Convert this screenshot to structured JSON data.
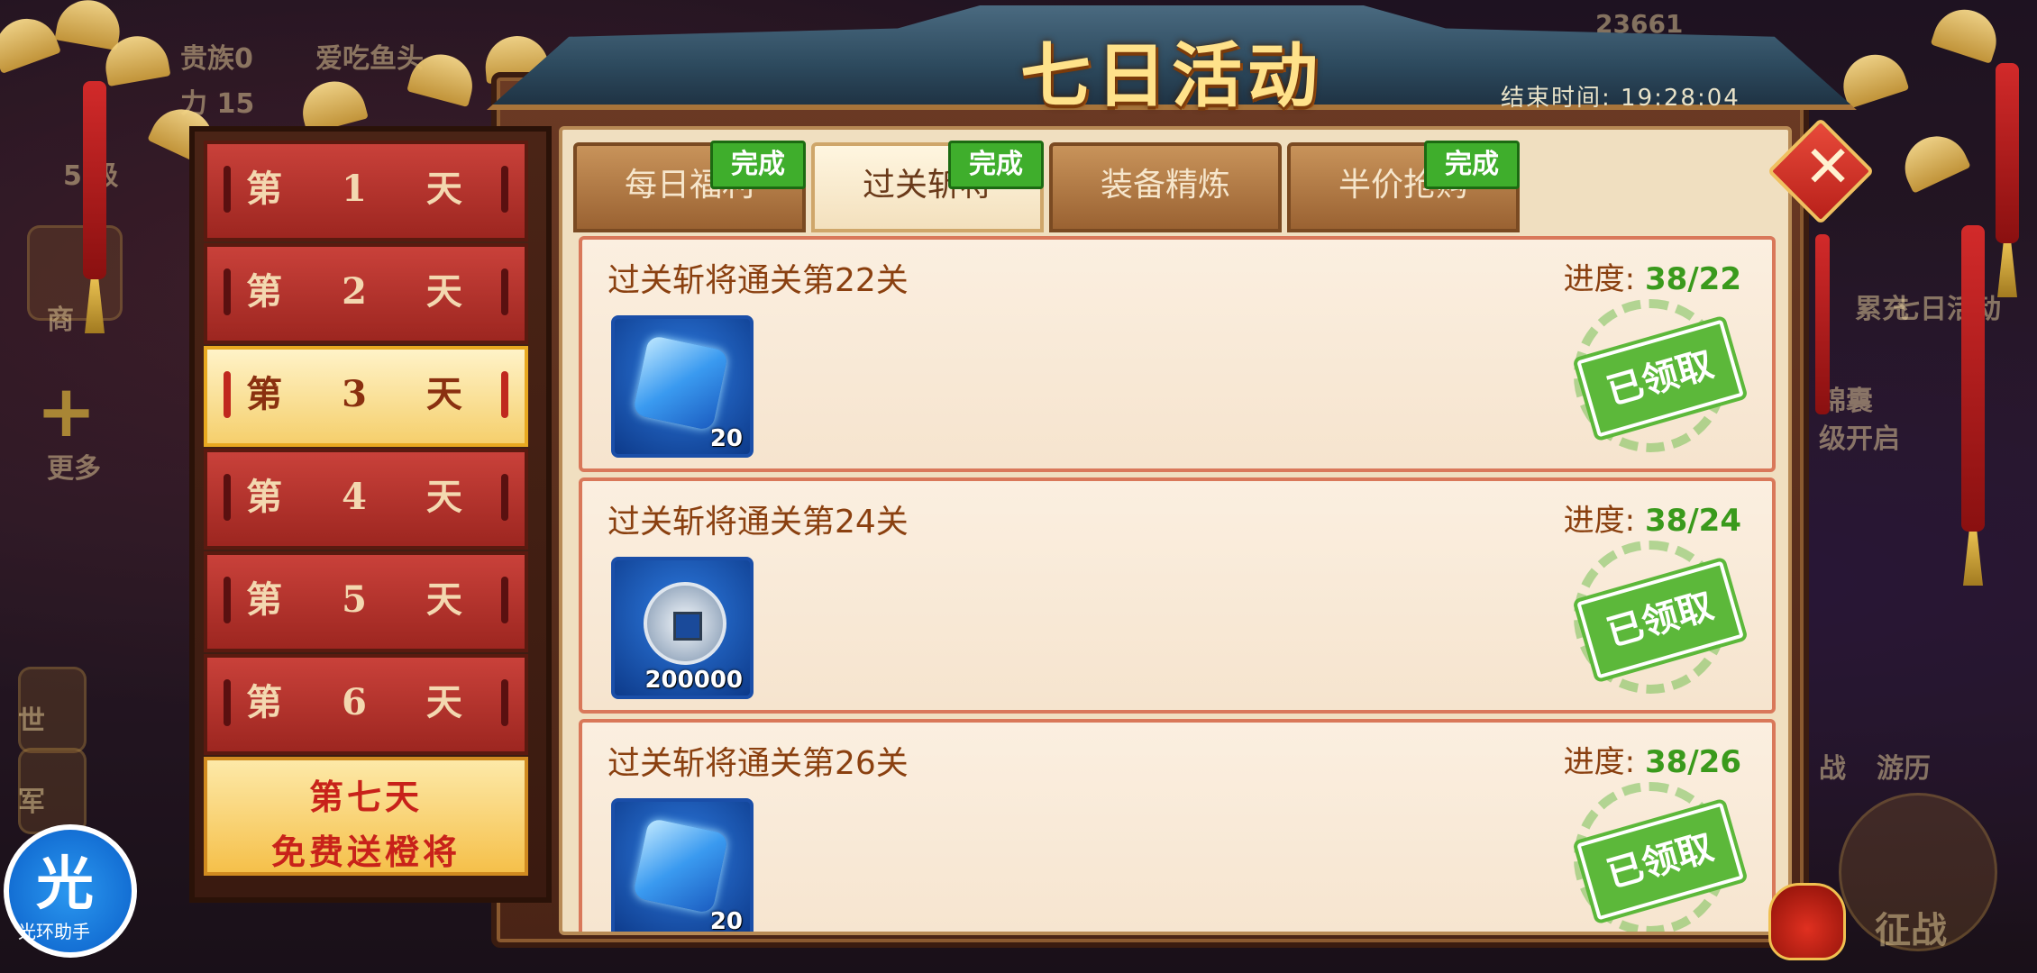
{
  "header": {
    "title": "七日活动",
    "end_time": "结束时间: 19:28:04"
  },
  "background_hud": {
    "score": "23661",
    "noble_text": "贵族0",
    "name_fragment": "爱吃鱼头",
    "power_fragment": "力 15",
    "level_fragment": "5 级",
    "shop_fragment": "商",
    "more_label": "更多",
    "world_fragment": "世",
    "military_fragment": "军",
    "charge_fragment": "累充",
    "seven_day_fragment": "七日活动",
    "bag_fragment": "锦囊",
    "open_fragment": "级开启",
    "battle_fragment": "战",
    "travel_fragment": "游历",
    "expedition_fragment": "征战"
  },
  "days": [
    {
      "label": "第 1 天",
      "active": false
    },
    {
      "label": "第 2 天",
      "active": false
    },
    {
      "label": "第 3 天",
      "active": true
    },
    {
      "label": "第 4 天",
      "active": false
    },
    {
      "label": "第 5 天",
      "active": false
    },
    {
      "label": "第 6 天",
      "active": false
    }
  ],
  "day7": {
    "line1": "第七天",
    "line2": "免费送橙将"
  },
  "tabs": [
    {
      "label": "每日福利",
      "badge": "完成",
      "active": false
    },
    {
      "label": "过关斩将",
      "badge": "完成",
      "active": true
    },
    {
      "label": "装备精炼",
      "badge": "",
      "active": false
    },
    {
      "label": "半价抢购",
      "badge": "完成",
      "active": false
    }
  ],
  "tasks": [
    {
      "title": "过关斩将通关第22关",
      "progress_label": "进度:",
      "progress": "38/22",
      "item": "blue-gem",
      "item_count": "20",
      "status": "已领取"
    },
    {
      "title": "过关斩将通关第24关",
      "progress_label": "进度:",
      "progress": "38/24",
      "item": "silver-coin",
      "item_count": "200000",
      "status": "已领取"
    },
    {
      "title": "过关斩将通关第26关",
      "progress_label": "进度:",
      "progress": "38/26",
      "item": "blue-gem",
      "item_count": "20",
      "status": "已领取"
    }
  ],
  "assistant": {
    "glyph": "光",
    "label": "光环助手"
  },
  "icons": {
    "close": "close-icon",
    "gem": "gem-icon",
    "coin": "coin-icon",
    "bag": "lucky-bag-icon"
  },
  "colors": {
    "accent": "#c9413a",
    "done": "#3fae2c",
    "progress": "#3a9a1c",
    "title": "#ffe28a"
  }
}
